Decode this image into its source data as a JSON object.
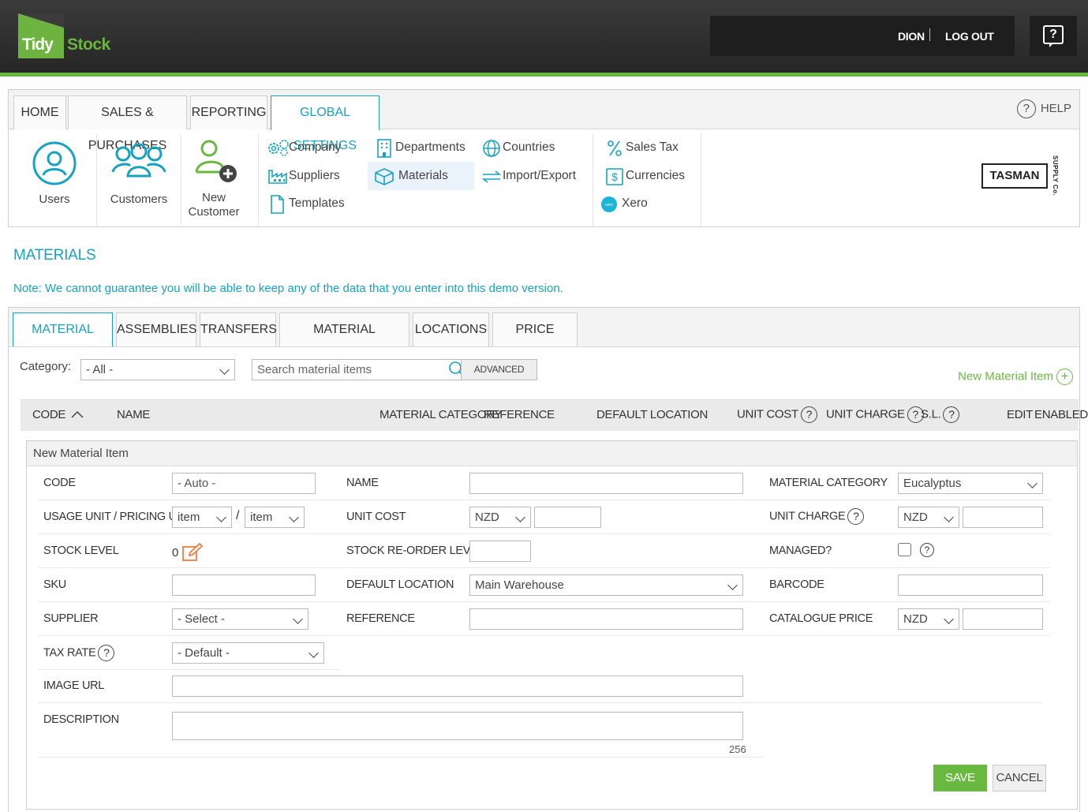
{
  "header": {
    "logo_tidy": "Tidy",
    "logo_stock": "Stock",
    "username": "DION",
    "logout": "LOG OUT",
    "help_glyph": "?"
  },
  "nav": {
    "tabs": [
      "HOME",
      "SALES & PURCHASES",
      "REPORTING",
      "GLOBAL SETTINGS"
    ],
    "active_tab": "GLOBAL SETTINGS",
    "help": "HELP",
    "big_items": [
      "Users",
      "Customers",
      "New",
      "Customer"
    ],
    "links": {
      "company": "Company",
      "suppliers": "Suppliers",
      "templates": "Templates",
      "departments": "Departments",
      "materials": "Materials",
      "countries": "Countries",
      "import_export": "Import/Export",
      "sales_tax": "Sales Tax",
      "currencies": "Currencies",
      "xero": "Xero"
    },
    "brand": "TASMAN",
    "brand_sub": "SUPPLY Co."
  },
  "page": {
    "title": "MATERIALS",
    "note": "Note: We cannot guarantee you will be able to keep any of the data that you enter into this demo version."
  },
  "materials": {
    "tabs": [
      "MATERIAL ITEMS",
      "ASSEMBLIES",
      "TRANSFERS",
      "MATERIAL CATEGORIES",
      "LOCATIONS",
      "PRICE LEVELS"
    ],
    "active_tab": "MATERIAL ITEMS",
    "category_label": "Category:",
    "category_value": "- All -",
    "search_placeholder": "Search material items",
    "advanced": "ADVANCED",
    "new_item": "New Material Item",
    "columns": {
      "code": "CODE",
      "name": "NAME",
      "material_category": "MATERIAL CATEGORY",
      "reference": "REFERENCE",
      "default_location": "DEFAULT LOCATION",
      "unit_cost": "UNIT COST",
      "unit_charge": "UNIT CHARGE",
      "sl": "S.L.",
      "edit": "EDIT",
      "enabled": "ENABLED"
    }
  },
  "form": {
    "title": "New Material Item",
    "labels": {
      "code": "CODE",
      "usage_unit": "USAGE UNIT / PRICING UNIT",
      "stock_level": "STOCK LEVEL",
      "sku": "SKU",
      "supplier": "SUPPLIER",
      "tax_rate": "TAX RATE",
      "image_url": "IMAGE URL",
      "description": "DESCRIPTION",
      "name": "NAME",
      "unit_cost": "UNIT COST",
      "stock_reorder": "STOCK RE-ORDER LEVEL",
      "default_location": "DEFAULT LOCATION",
      "reference": "REFERENCE",
      "material_category": "MATERIAL CATEGORY",
      "unit_charge": "UNIT CHARGE",
      "managed": "MANAGED?",
      "barcode": "BARCODE",
      "catalogue_price": "CATALOGUE PRICE"
    },
    "values": {
      "code": "- Auto -",
      "usage_unit": "item",
      "pricing_unit": "item",
      "unit_separator": "/",
      "stock_level": "0",
      "supplier": "- Select -",
      "tax_rate": "- Default -",
      "unit_cost_currency": "NZD",
      "default_location": "Main Warehouse",
      "material_category": "Eucalyptus",
      "unit_charge_currency": "NZD",
      "catalogue_currency": "NZD",
      "char_count": "256"
    },
    "save": "SAVE",
    "cancel": "CANCEL"
  },
  "colors": {
    "accent": "#16a3c1",
    "brand_green": "#69b840",
    "header_dark": "#2e2e2e"
  }
}
